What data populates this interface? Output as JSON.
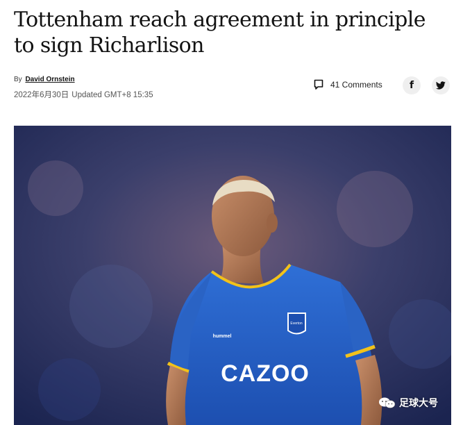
{
  "article": {
    "headline": "Tottenham reach agreement in principle to sign Richarlison",
    "byline_prefix": "By",
    "author": "David Ornstein",
    "date": "2022年6月30日",
    "updated": "Updated GMT+8 15:35"
  },
  "actions": {
    "comments_label": "41 Comments",
    "facebook_glyph": "f",
    "comments_icon": "comment-icon",
    "twitter_icon": "twitter-icon"
  },
  "hero": {
    "jersey_sponsor": "CAZOO",
    "kit_brand": "hummel",
    "badge_text": "Everton"
  },
  "watermark": {
    "label": "足球大号",
    "icon": "wechat-icon"
  }
}
